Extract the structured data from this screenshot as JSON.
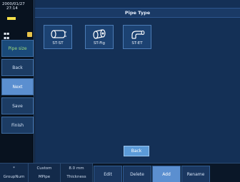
{
  "status": {
    "date": "2000/01/27",
    "time": "27:14",
    "signal": "▪▪ ▪▪"
  },
  "sidebar": {
    "items": [
      {
        "label": "Pipe size"
      },
      {
        "label": "Back"
      },
      {
        "label": "Next"
      },
      {
        "label": "Save"
      },
      {
        "label": "Finish"
      }
    ]
  },
  "main": {
    "title": "Pipe Type",
    "tiles": [
      {
        "label": "ST-ST",
        "icon": "straight-pipe-icon"
      },
      {
        "label": "ST-Fig",
        "icon": "pipe-fitting-icon"
      },
      {
        "label": "ST-ET",
        "icon": "elbow-pipe-icon"
      }
    ],
    "back_label": "Back"
  },
  "bottom": {
    "cells": [
      {
        "top": "*",
        "bottom": "GroupNum"
      },
      {
        "top": "Custom",
        "bottom": "MPipe"
      },
      {
        "top": "8.0 mm",
        "bottom": "Thickness"
      }
    ],
    "actions": [
      {
        "label": "Edit"
      },
      {
        "label": "Delete"
      },
      {
        "label": "Add"
      },
      {
        "label": "Rename"
      }
    ]
  },
  "colors": {
    "accent": "#5b8fd0",
    "panel": "#143056",
    "active_text": "#9fdd7a"
  }
}
